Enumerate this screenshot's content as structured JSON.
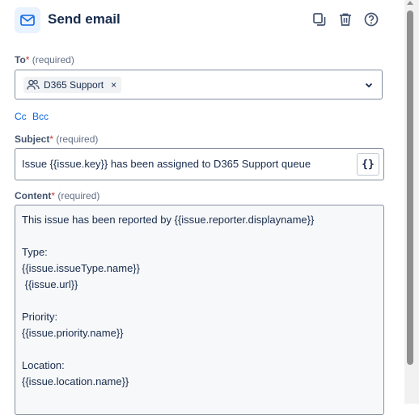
{
  "header": {
    "title": "Send email",
    "icon": "mail-icon",
    "actions": [
      "copy-icon",
      "trash-icon",
      "help-icon"
    ]
  },
  "to": {
    "label": "To",
    "required_mark": "*",
    "required_text": "(required)",
    "recipients": [
      {
        "icon": "group-icon",
        "name": "D365 Support",
        "remove": "×"
      }
    ]
  },
  "links": {
    "cc": "Cc",
    "bcc": "Bcc"
  },
  "subject": {
    "label": "Subject",
    "required_mark": "*",
    "required_text": "(required)",
    "value": "Issue {{issue.key}} has been assigned to D365 Support queue",
    "smart_value_button": "{}"
  },
  "content": {
    "label": "Content",
    "required_mark": "*",
    "required_text": "(required)",
    "value": "This issue has been reported by {{issue.reporter.displayname}}\n\nType:\n{{issue.issueType.name}}\n {{issue.url}}\n\nPriority:\n{{issue.priority.name}}\n\nLocation:\n{{issue.location.name}}"
  },
  "colors": {
    "accent": "#0c66e4",
    "required_star": "#c9372c",
    "icon_bg": "#e9f2ff"
  }
}
